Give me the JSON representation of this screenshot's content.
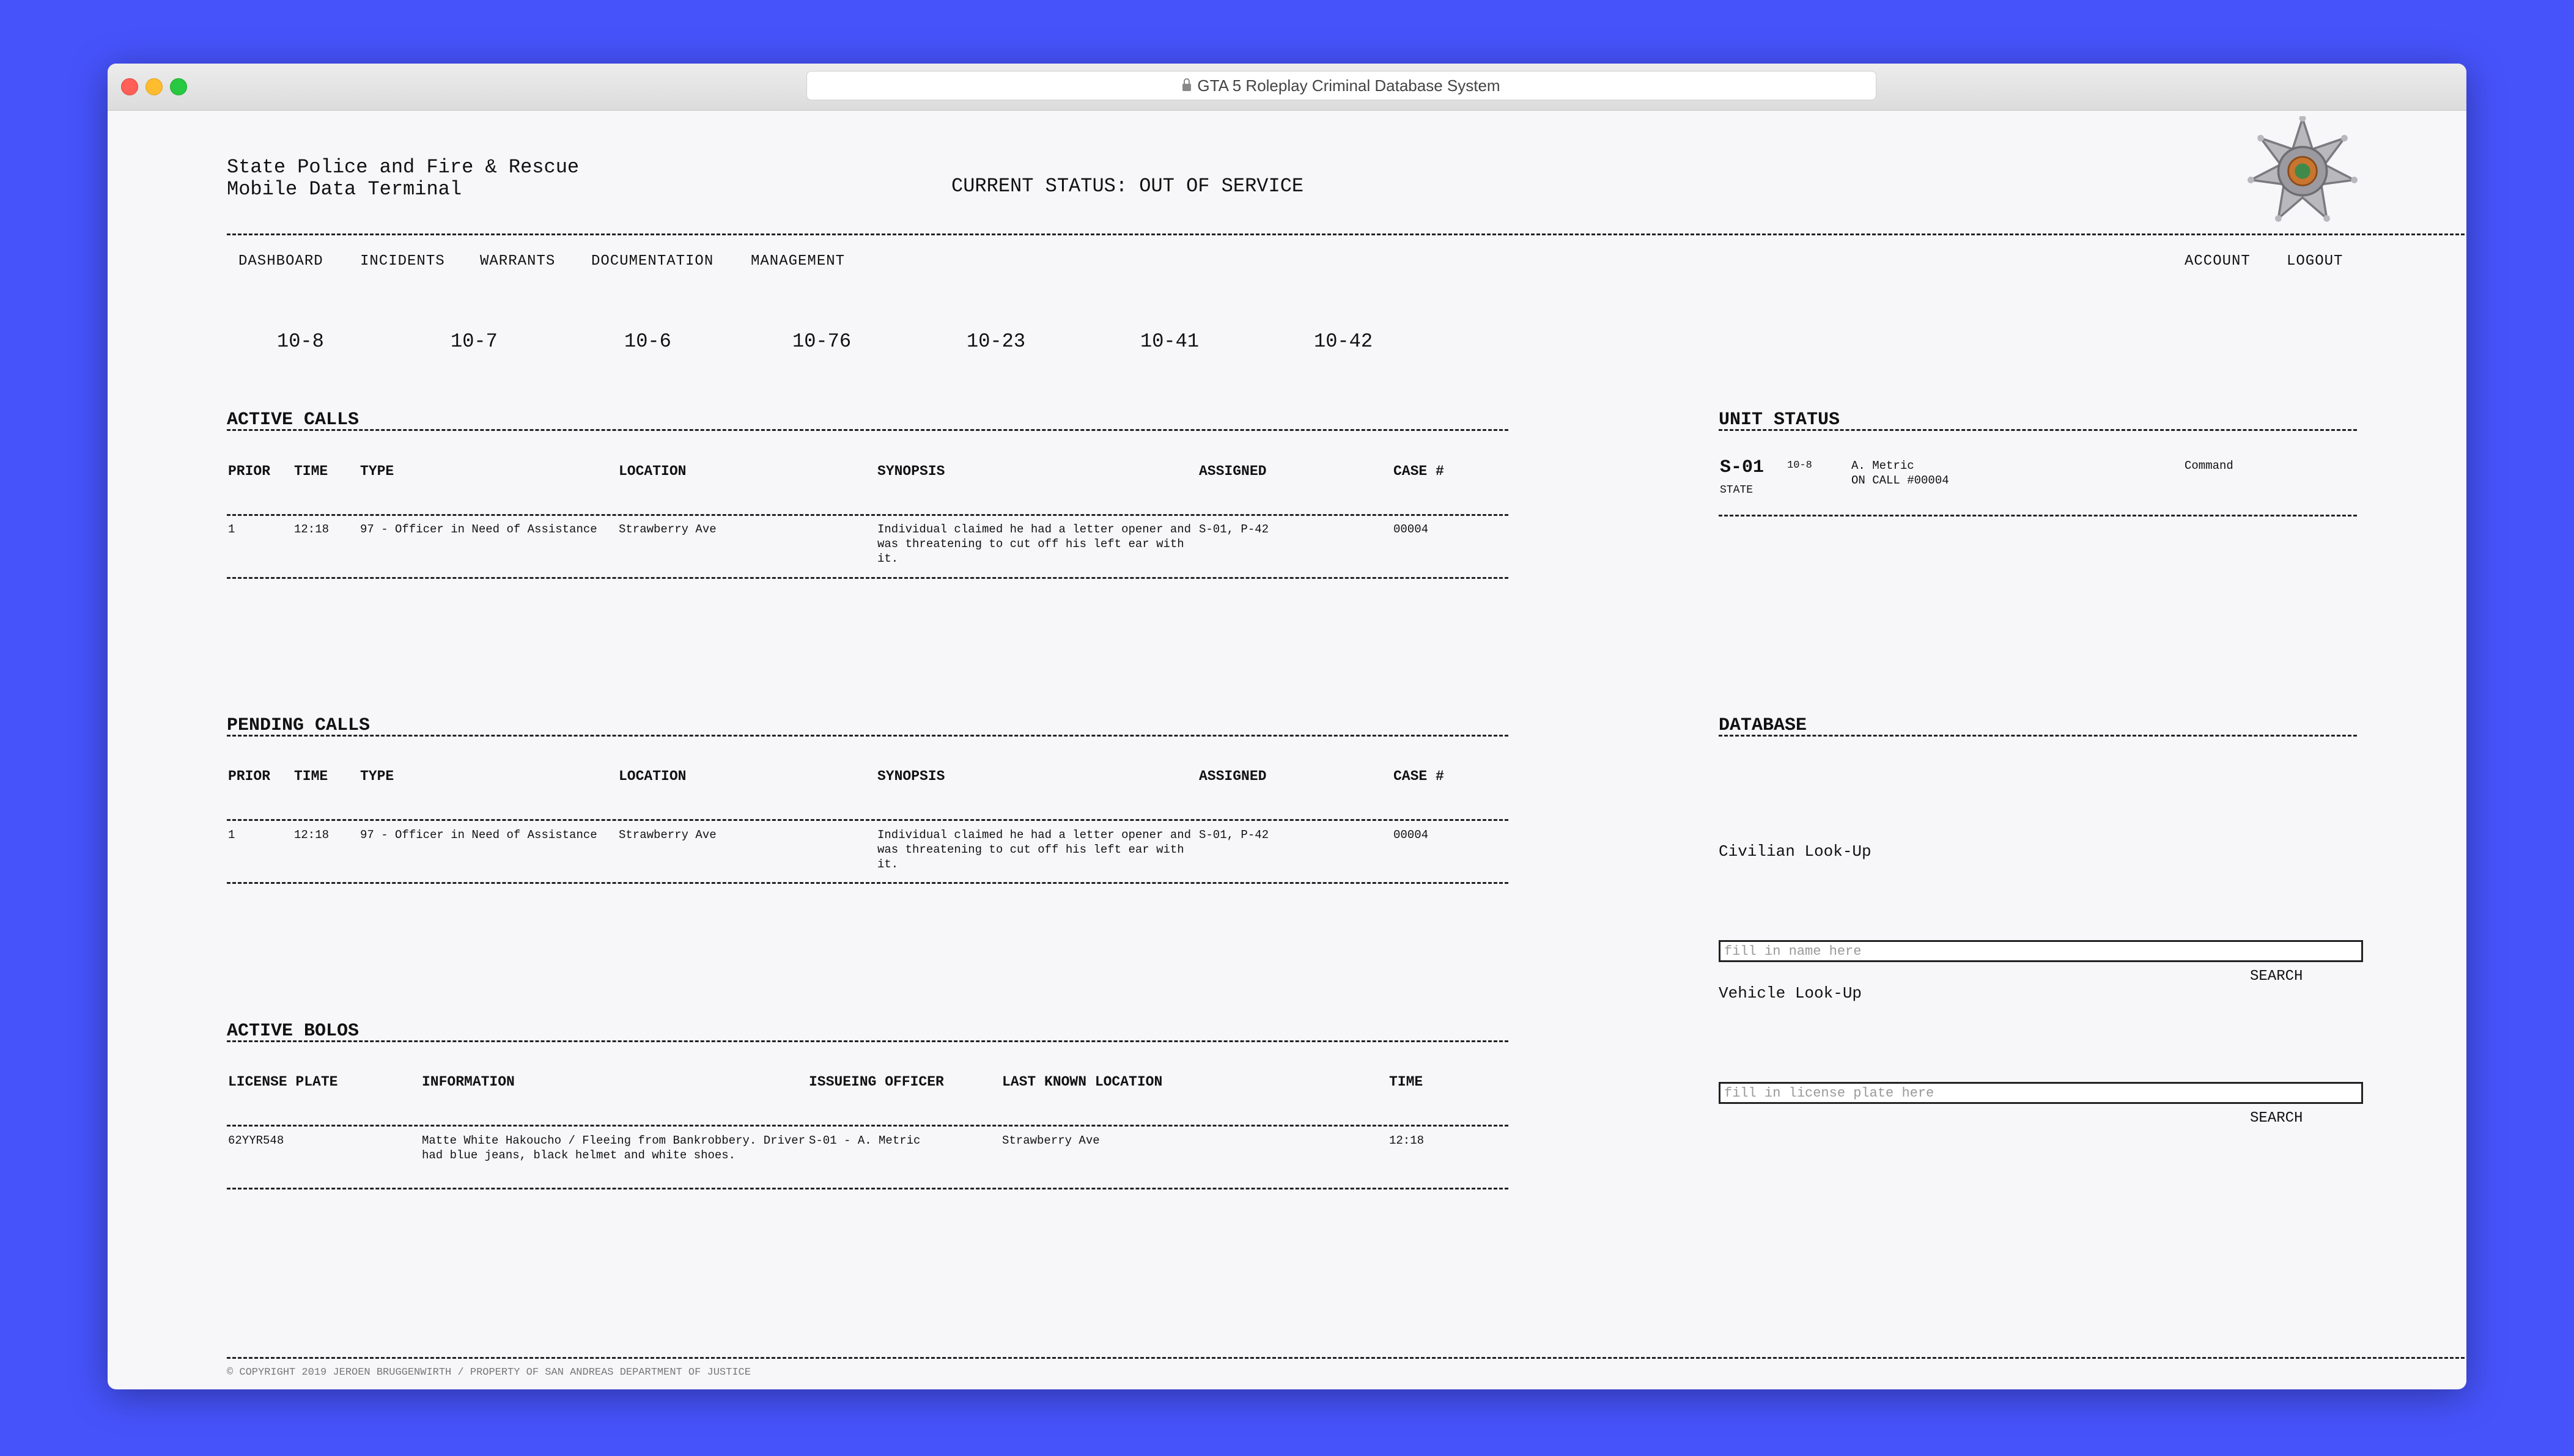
{
  "browser": {
    "url_title": "GTA 5 Roleplay Criminal Database System"
  },
  "header": {
    "org_line1": "State Police and Fire & Rescue",
    "org_line2": "Mobile Data Terminal",
    "status": "CURRENT STATUS: OUT OF SERVICE"
  },
  "nav": {
    "items": [
      "DASHBOARD",
      "INCIDENTS",
      "WARRANTS",
      "DOCUMENTATION",
      "MANAGEMENT"
    ],
    "account": "ACCOUNT",
    "logout": "LOGOUT"
  },
  "status_codes": [
    "10-8",
    "10-7",
    "10-6",
    "10-76",
    "10-23",
    "10-41",
    "10-42"
  ],
  "calls_columns": [
    "PRIOR",
    "TIME",
    "TYPE",
    "LOCATION",
    "SYNOPSIS",
    "ASSIGNED",
    "CASE #"
  ],
  "active_calls": {
    "title": "ACTIVE CALLS",
    "rows": [
      {
        "prior": "1",
        "time": "12:18",
        "type": "97 - Officer in Need of Assistance",
        "location": "Strawberry Ave",
        "synopsis": "Individual claimed he had a letter opener and was threatening to cut off his left ear with it.",
        "assigned": "S-01, P-42",
        "case": "00004"
      }
    ]
  },
  "pending_calls": {
    "title": "PENDING CALLS",
    "rows": [
      {
        "prior": "1",
        "time": "12:18",
        "type": "97 - Officer in Need of Assistance",
        "location": "Strawberry Ave",
        "synopsis": "Individual claimed he had a letter opener and was threatening to cut off his left ear with it.",
        "assigned": "S-01, P-42",
        "case": "00004"
      }
    ]
  },
  "active_bolos": {
    "title": "ACTIVE BOLOS",
    "columns": [
      "LICENSE PLATE",
      "INFORMATION",
      "ISSUEING OFFICER",
      "LAST KNOWN LOCATION",
      "TIME"
    ],
    "rows": [
      {
        "plate": "62YYR548",
        "information": "Matte White Hakoucho / Fleeing from Bankrobbery. Driver had blue jeans, black helmet and white shoes.",
        "officer": "S-01 - A. Metric",
        "location": "Strawberry Ave",
        "time": "12:18"
      }
    ]
  },
  "unit_status": {
    "title": "UNIT STATUS",
    "unit": "S-01",
    "agency": "STATE",
    "code": "10-8",
    "name": "A. Metric",
    "call": "ON CALL #00004",
    "role": "Command"
  },
  "database": {
    "title": "DATABASE",
    "civilian_label": "Civilian Look-Up",
    "civilian_placeholder": "fill in name here",
    "vehicle_label": "Vehicle Look-Up",
    "vehicle_placeholder": "fill in license plate here",
    "search_label": "SEARCH"
  },
  "footer": "© COPYRIGHT 2019 JEROEN BRUGGENWIRTH / PROPERTY OF SAN ANDREAS DEPARTMENT OF JUSTICE",
  "icons": {
    "badge": "state-police-star-badge-icon",
    "lock": "lock-icon"
  }
}
